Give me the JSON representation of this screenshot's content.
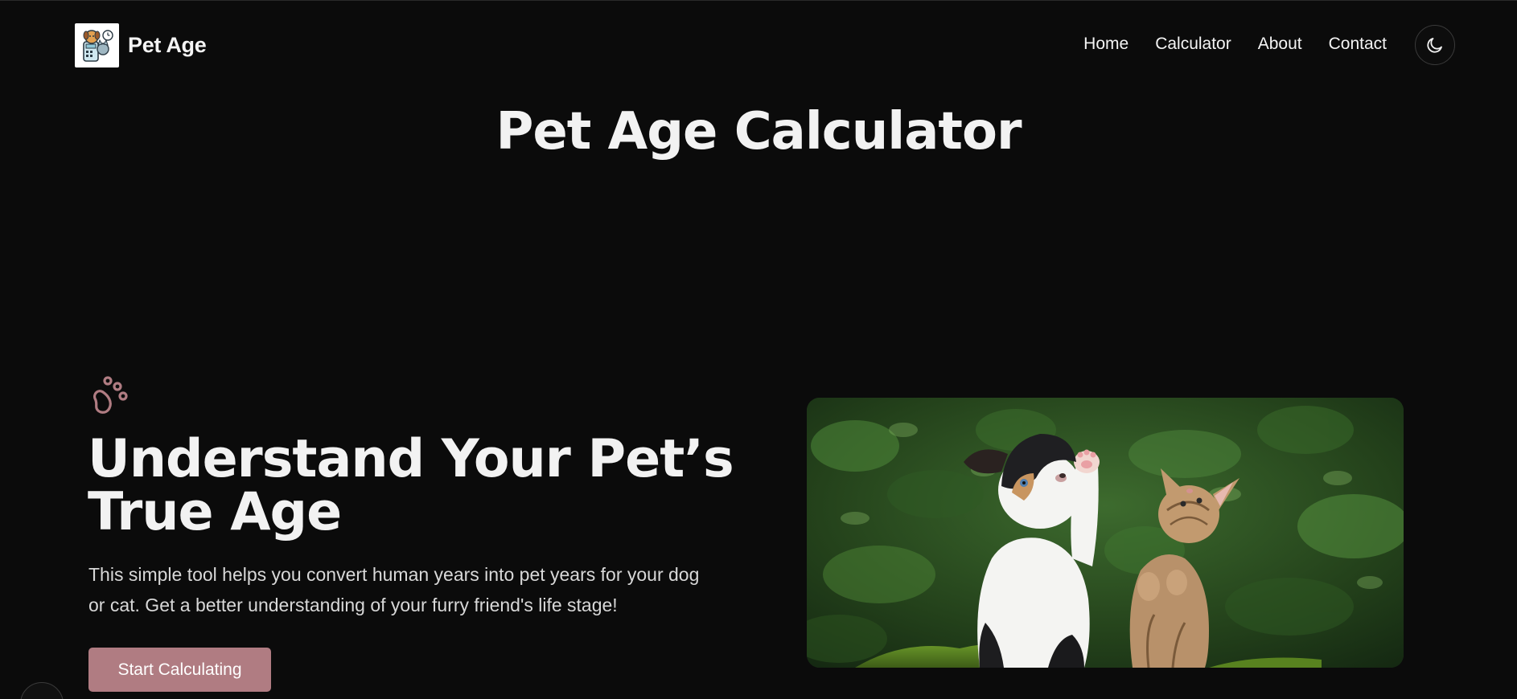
{
  "header": {
    "brand_name": "Pet Age",
    "logo_icon": "pet-calculator-logo",
    "nav": [
      "Home",
      "Calculator",
      "About",
      "Contact"
    ],
    "theme_toggle_icon": "moon-icon"
  },
  "main": {
    "title": "Pet Age Calculator",
    "hero": {
      "icon": "paw-icon",
      "heading": "Understand Your Pet’s True Age",
      "description": "This simple tool helps you convert human years into pet years for your dog or cat. Get a better understanding of your furry friend's life stage!",
      "cta_label": "Start Calculating",
      "image_subject": "puppy-and-kitten-photo"
    }
  },
  "colors": {
    "background": "#0b0b0b",
    "accent": "#b07c82",
    "text": "#f2f2f2"
  }
}
